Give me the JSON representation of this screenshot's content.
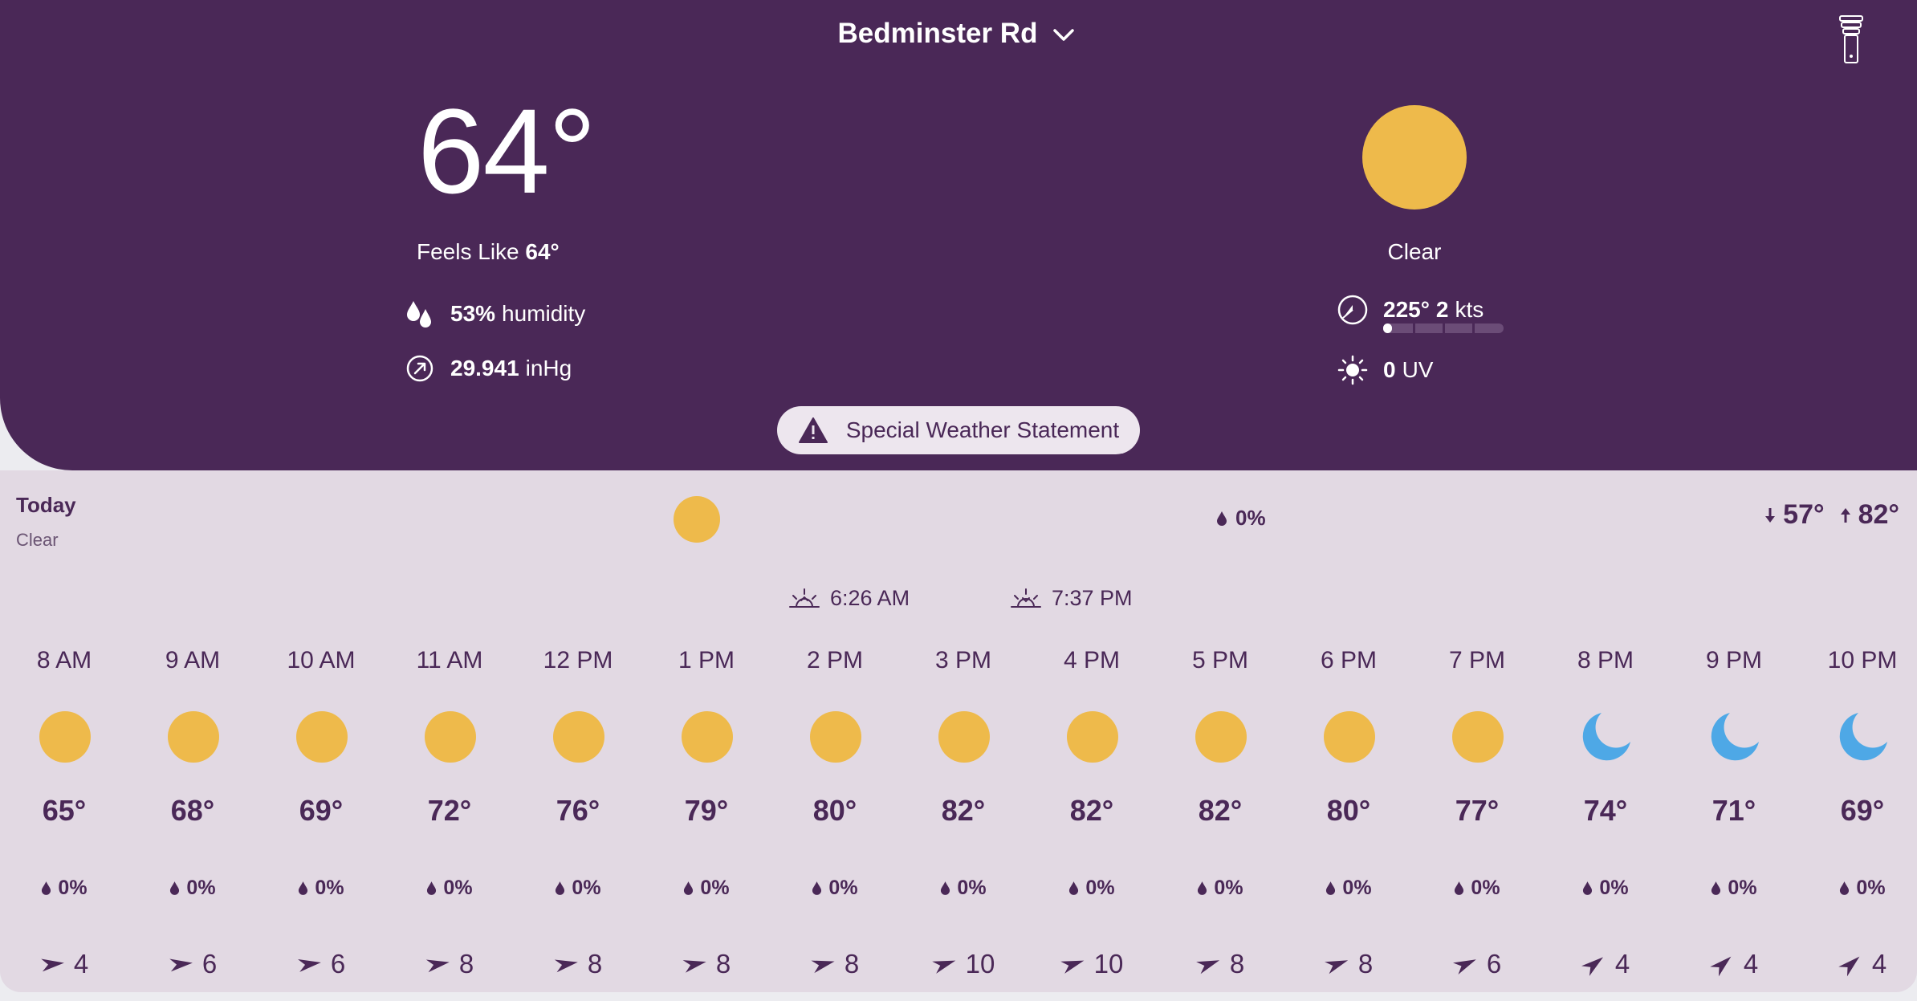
{
  "header": {
    "location": "Bedminster Rd",
    "temperature": "64°",
    "feels_like_label": "Feels Like",
    "feels_like_value": "64°",
    "humidity_value": "53%",
    "humidity_unit": "humidity",
    "pressure_value": "29.941",
    "pressure_unit": "inHg",
    "condition": "Clear",
    "wind_dir": "225°",
    "wind_speed": "2",
    "wind_unit": "kts",
    "wind_level": 0.07,
    "uv_value": "0",
    "uv_unit": "UV",
    "alert": "Special Weather Statement"
  },
  "today": {
    "title": "Today",
    "condition": "Clear",
    "precip": "0%",
    "low": "57°",
    "high": "82°",
    "sunrise": "6:26 AM",
    "sunset": "7:37 PM"
  },
  "hours": [
    {
      "time": "8 AM",
      "icon": "sun-icon",
      "temp": "65°",
      "precip": "0%",
      "wind": "4"
    },
    {
      "time": "9 AM",
      "icon": "sun-icon",
      "temp": "68°",
      "precip": "0%",
      "wind": "6"
    },
    {
      "time": "10 AM",
      "icon": "sun-icon",
      "temp": "69°",
      "precip": "0%",
      "wind": "6"
    },
    {
      "time": "11 AM",
      "icon": "sun-icon",
      "temp": "72°",
      "precip": "0%",
      "wind": "8"
    },
    {
      "time": "12 PM",
      "icon": "sun-icon",
      "temp": "76°",
      "precip": "0%",
      "wind": "8"
    },
    {
      "time": "1 PM",
      "icon": "sun-icon",
      "temp": "79°",
      "precip": "0%",
      "wind": "8"
    },
    {
      "time": "2 PM",
      "icon": "sun-icon",
      "temp": "80°",
      "precip": "0%",
      "wind": "8"
    },
    {
      "time": "3 PM",
      "icon": "sun-icon",
      "temp": "82°",
      "precip": "0%",
      "wind": "10"
    },
    {
      "time": "4 PM",
      "icon": "sun-icon",
      "temp": "82°",
      "precip": "0%",
      "wind": "10"
    },
    {
      "time": "5 PM",
      "icon": "sun-icon",
      "temp": "82°",
      "precip": "0%",
      "wind": "8"
    },
    {
      "time": "6 PM",
      "icon": "sun-icon",
      "temp": "80°",
      "precip": "0%",
      "wind": "8"
    },
    {
      "time": "7 PM",
      "icon": "sun-icon",
      "temp": "77°",
      "precip": "0%",
      "wind": "6"
    },
    {
      "time": "8 PM",
      "icon": "moon-icon",
      "temp": "74°",
      "precip": "0%",
      "wind": "4"
    },
    {
      "time": "9 PM",
      "icon": "moon-icon",
      "temp": "71°",
      "precip": "0%",
      "wind": "4"
    },
    {
      "time": "10 PM",
      "icon": "moon-icon",
      "temp": "69°",
      "precip": "0%",
      "wind": "4"
    }
  ],
  "colors": {
    "header_bg": "#4a2857",
    "panel_bg": "#e2d9e3",
    "sun": "#eeba4b",
    "moon": "#4ea8e6"
  }
}
